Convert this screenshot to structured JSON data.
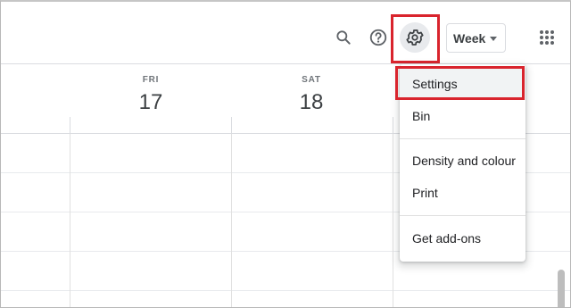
{
  "toolbar": {
    "search_icon": "search-icon",
    "help_icon": "help-icon",
    "settings_icon": "gear-icon",
    "view_selector": "Week",
    "apps_icon": "apps-grid-icon"
  },
  "days": [
    {
      "name": "FRI",
      "number": "17"
    },
    {
      "name": "SAT",
      "number": "18"
    }
  ],
  "settings_menu": {
    "items": [
      "Settings",
      "Bin",
      "Density and colour",
      "Print",
      "Get add-ons"
    ]
  },
  "colors": {
    "highlight": "#d9242d",
    "divider": "#dadce0",
    "text": "#3c4043"
  }
}
